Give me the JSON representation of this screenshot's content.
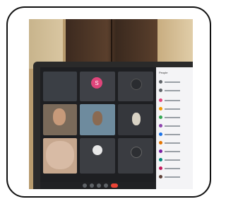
{
  "scene": {
    "description_tags": [
      "laptop",
      "video-call",
      "participants-panel"
    ]
  },
  "meeting": {
    "center_avatar_letter": "S",
    "panel_title": "People",
    "participant_count": 10
  },
  "colors": {
    "avatar_pink": "#e0457b",
    "avatar_green": "#34a853",
    "end_call_red": "#ea4335",
    "panel_bg": "#f4f4f6"
  }
}
